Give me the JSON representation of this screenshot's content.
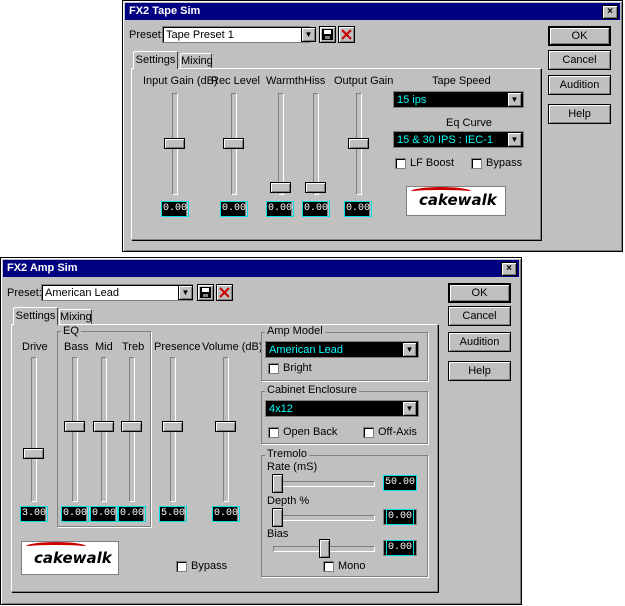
{
  "tape": {
    "title": "FX2 Tape Sim",
    "close": "×",
    "preset_label": "Preset:",
    "preset_value": "Tape Preset 1",
    "tabs": [
      "Settings",
      "Mixing"
    ],
    "sliders": [
      {
        "label": "Input Gain (dB)",
        "value": "0.00",
        "level": 0.5
      },
      {
        "label": "Rec Level",
        "value": "0.00",
        "level": 0.5
      },
      {
        "label": "Warmth",
        "value": "0.00",
        "level": 0.0
      },
      {
        "label": "Hiss",
        "value": "0.00",
        "level": 0.0
      },
      {
        "label": "Output Gain",
        "value": "0.00",
        "level": 0.5
      }
    ],
    "tape_speed_label": "Tape Speed",
    "tape_speed_value": "15 ips",
    "eq_curve_label": "Eq Curve",
    "eq_curve_value": "15 & 30 IPS : IEC-1",
    "lf_boost": "LF Boost",
    "bypass": "Bypass",
    "logo": "cakewalk",
    "buttons": [
      "OK",
      "Cancel",
      "Audition",
      "Help"
    ]
  },
  "amp": {
    "title": "FX2 Amp Sim",
    "close": "×",
    "preset_label": "Preset:",
    "preset_value": "American Lead",
    "tabs": [
      "Settings",
      "Mixing"
    ],
    "drive": {
      "label": "Drive",
      "value": "3.00",
      "level": 0.3
    },
    "eq_label": "EQ",
    "eq": [
      {
        "label": "Bass",
        "value": "0.00",
        "level": 0.5
      },
      {
        "label": "Mid",
        "value": "0.00",
        "level": 0.5
      },
      {
        "label": "Treb",
        "value": "0.00",
        "level": 0.5
      }
    ],
    "presence": {
      "label": "Presence",
      "value": "5.00",
      "level": 0.5
    },
    "volume": {
      "label": "Volume (dB)",
      "value": "0.00",
      "level": 0.5
    },
    "amp_model_label": "Amp Model",
    "amp_model_value": "American Lead",
    "bright": "Bright",
    "cabinet_label": "Cabinet Enclosure",
    "cabinet_value": "4x12",
    "open_back": "Open Back",
    "off_axis": "Off-Axis",
    "tremolo_label": "Tremolo",
    "rate_label": "Rate (mS)",
    "rate_value": "50.00",
    "depth_label": "Depth %",
    "depth_value": "0.00",
    "bias_label": "Bias",
    "bias_value": "0.00",
    "mono": "Mono",
    "bypass": "Bypass",
    "logo": "cakewalk",
    "buttons": [
      "OK",
      "Cancel",
      "Audition",
      "Help"
    ]
  }
}
